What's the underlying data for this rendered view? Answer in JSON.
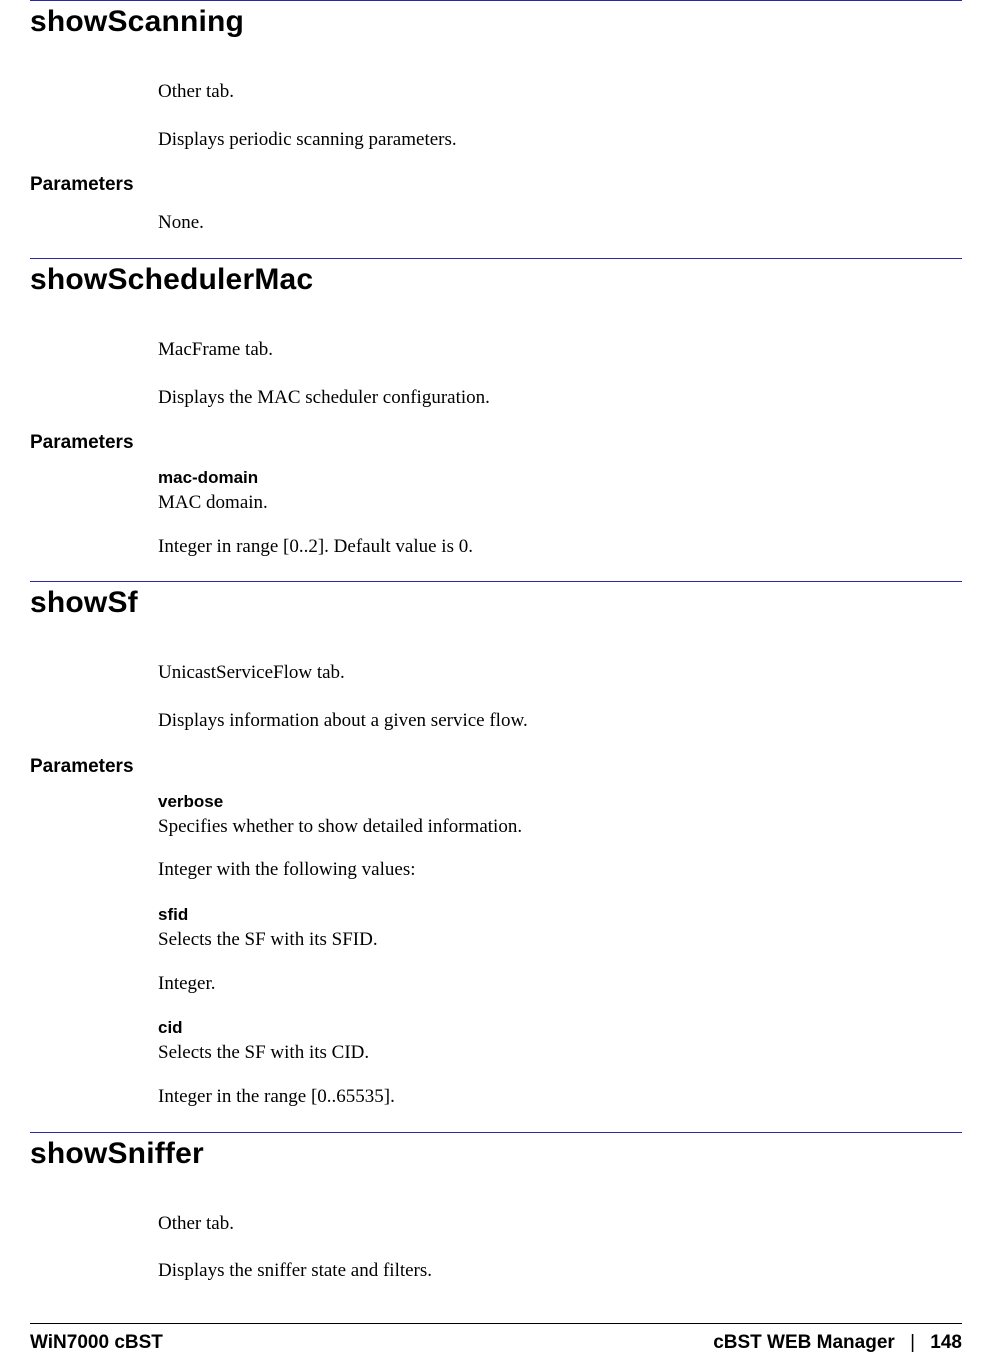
{
  "sections": [
    {
      "title": "showScanning",
      "intro": [
        "Other tab.",
        "Displays periodic scanning parameters."
      ],
      "params_heading": "Parameters",
      "params_none": "None.",
      "params": []
    },
    {
      "title": "showSchedulerMac",
      "intro": [
        "MacFrame tab.",
        "Displays the MAC scheduler configuration."
      ],
      "params_heading": "Parameters",
      "params": [
        {
          "name": "mac-domain",
          "desc": "MAC domain.",
          "detail": "Integer in range [0..2]. Default value is 0."
        }
      ]
    },
    {
      "title": "showSf",
      "intro": [
        "UnicastServiceFlow tab.",
        "Displays information about a given service flow."
      ],
      "params_heading": "Parameters",
      "params": [
        {
          "name": "verbose",
          "desc": "Specifies whether to show detailed information.",
          "detail": "Integer with the following values:"
        },
        {
          "name": "sfid",
          "desc": "Selects the SF with its SFID.",
          "detail": "Integer."
        },
        {
          "name": "cid",
          "desc": "Selects the SF with its CID.",
          "detail": "Integer in the range [0..65535]."
        }
      ]
    },
    {
      "title": "showSniffer",
      "intro": [
        "Other tab.",
        "Displays the sniffer state and filters."
      ],
      "params_heading": "",
      "params": []
    }
  ],
  "footer": {
    "left": "WiN7000 cBST",
    "right_doc": "cBST WEB Manager",
    "separator": "|",
    "page": "148"
  }
}
